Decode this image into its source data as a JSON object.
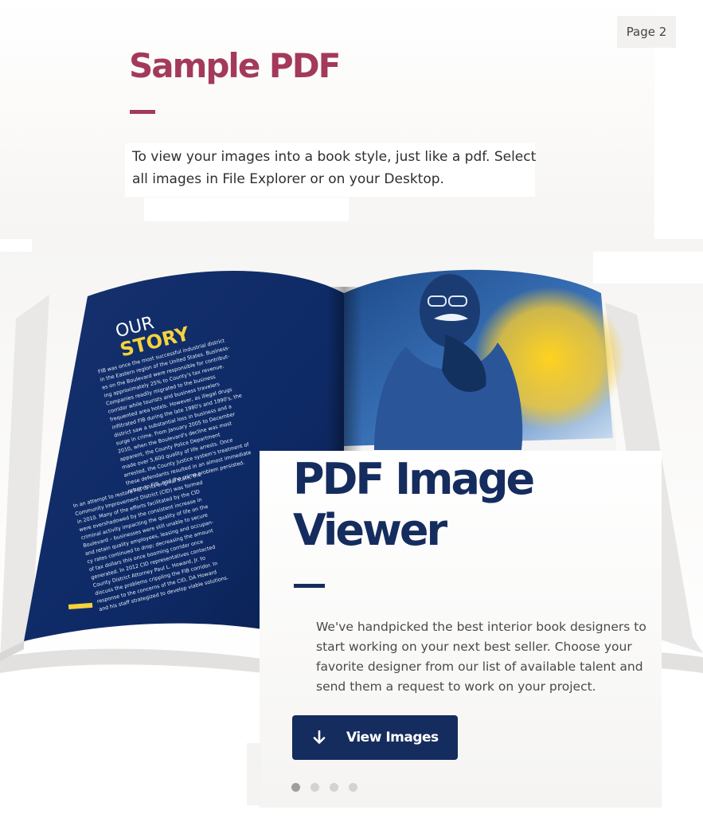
{
  "page_badge": "Page 2",
  "header": {
    "title": "Sample PDF",
    "description": "To view your images into a book style, just like a pdf. Select all images in File Explorer or on your Desktop."
  },
  "book_spread": {
    "heading_top": "OUR",
    "heading_bottom": "STORY",
    "paragraph_1": [
      "FIB was once the most successful industrial district",
      "in the Eastern region of the United States. Business-",
      "es on the Boulevard were responsible for contribut-",
      "ing approximately 25% to County's tax revenue.",
      "Companies readily migrated to the business",
      "corridor while tourists and business travelers",
      "frequented area hotels. However, as illegal drugs",
      "infiltrated FIB during the late 1980's and 1990's, the",
      "district saw a substantial loss in business and a",
      "surge in crime. From January 2005 to December",
      "2010, when the Boulevard's decline was most",
      "apparent, the County Police Department",
      "made over 5,600 quality of life arrests. Once",
      "arrested, the County Justice system's treatment of",
      "these defendants resulted in an almost immediate",
      "return to FIB, and the crime problem persisted."
    ],
    "paragraph_2": [
      "In an attempt to restore FIB to its original state, the",
      "Community Improvement District (CID) was formed",
      "in 2010. Many of the efforts facilitated by the CID",
      "were overshadowed by the consistent increase in",
      "criminal activity impacting the quality of life on the",
      "Boulevard – businesses were still unable to secure",
      "and retain quality employees, leasing and occupan-",
      "cy rates continued to drop; decreasing the amount",
      "of tax dollars this once booming corridor once",
      "generated. In 2012 CID representatives contacted",
      "County District Attorney Paul L. Howard, Jr. to",
      "discuss the problems crippling the FIB corridor. In",
      "response to the concerns of the CID, DA Howard",
      "and his staff strategized to develop viable solutions."
    ]
  },
  "card": {
    "title_line1": "PDF Image",
    "title_line2": "Viewer",
    "body": "We've handpicked the best interior book designers to start working on your next best seller. Choose your favorite designer from our list of available talent and send them a request to work on your project.",
    "button_label": "View Images",
    "button_icon": "arrow-down-icon"
  },
  "carousel": {
    "slide_count": 4,
    "active_index": 0
  },
  "colors": {
    "brand_maroon": "#a33a5a",
    "brand_navy": "#152c5e",
    "book_blue": "#0f2a63",
    "accent_yellow": "#f5d33a"
  }
}
